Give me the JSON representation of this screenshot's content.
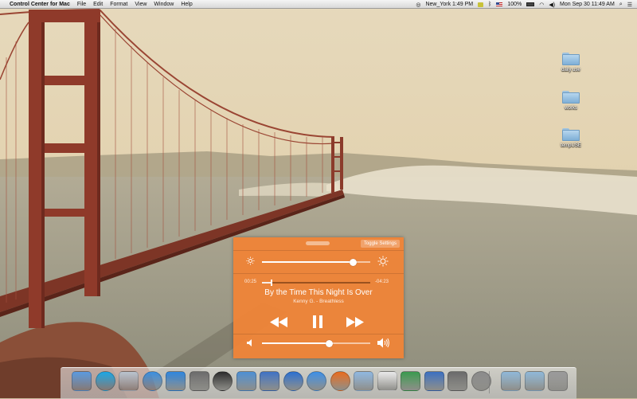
{
  "menubar": {
    "app_name": "Control Center for Mac",
    "menus": [
      "File",
      "Edit",
      "Format",
      "View",
      "Window",
      "Help"
    ],
    "clock_city": "New_York 1:49 PM",
    "battery": "100%",
    "datetime": "Mon Sep 30  11:49 AM"
  },
  "desktop": {
    "items": [
      {
        "label": "daily use"
      },
      {
        "label": "works"
      },
      {
        "label": "tempUSE"
      }
    ]
  },
  "widget": {
    "toggle_label": "Toggle Settings",
    "brightness_level": 0.84,
    "elapsed": "00:25",
    "remaining": "-04:23",
    "progress": 0.09,
    "song_title": "By the Time This Night Is Over",
    "artist_album": "Kenny G. - Breathless",
    "volume_level": 0.62
  },
  "dock": {
    "apps": [
      {
        "icon": "finder-icon",
        "color": "#5a9ae0"
      },
      {
        "icon": "skype-icon",
        "color": "#1ba7e6"
      },
      {
        "icon": "rocket-icon",
        "color": "#b9c3cf"
      },
      {
        "icon": "itunes-icon",
        "color": "#3b8fe0"
      },
      {
        "icon": "app-store-icon",
        "color": "#2f86de"
      },
      {
        "icon": "photo-booth-icon",
        "color": "#6b6b6b"
      },
      {
        "icon": "dashboard-icon",
        "color": "#2b2b2b"
      },
      {
        "icon": "preview-icon",
        "color": "#4d8fd3"
      },
      {
        "icon": "xcode-icon",
        "color": "#3f72c4"
      },
      {
        "icon": "google-earth-icon",
        "color": "#2a6fd0"
      },
      {
        "icon": "safari-icon",
        "color": "#3c8fe6"
      },
      {
        "icon": "firefox-icon",
        "color": "#e86b1d"
      },
      {
        "icon": "mail-icon",
        "color": "#8fb7e0"
      },
      {
        "icon": "textedit-icon",
        "color": "#e9e9e9"
      },
      {
        "icon": "coda-icon",
        "color": "#3a9a4e"
      },
      {
        "icon": "xcode-tools-icon",
        "color": "#3b6fc0"
      },
      {
        "icon": "facetime-icon",
        "color": "#6a6a6a"
      },
      {
        "icon": "system-preferences-icon",
        "color": "#8a8a8a"
      },
      {
        "icon": "applications-folder-icon",
        "color": "#8fb8d8"
      },
      {
        "icon": "downloads-folder-icon",
        "color": "#8fb8d8"
      },
      {
        "icon": "trash-icon",
        "color": "#9a9a9a"
      }
    ]
  }
}
